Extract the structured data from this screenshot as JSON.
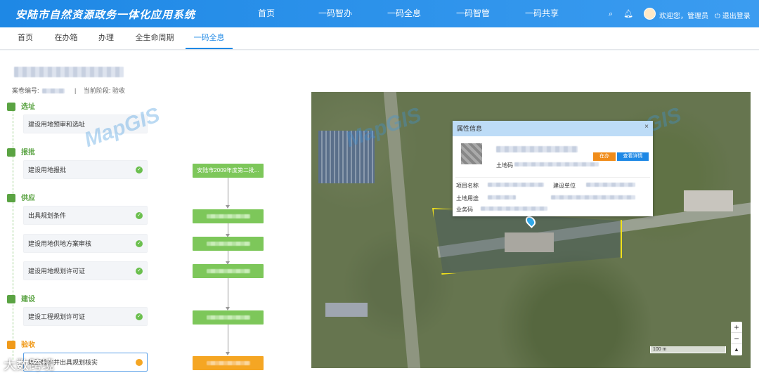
{
  "header": {
    "app_title": "安陆市自然资源政务一体化应用系统",
    "nav": [
      "首页",
      "一码智办",
      "一码全息",
      "一码智管",
      "一码共享"
    ],
    "search_icon": "search-icon",
    "bell_icon": "bell-icon",
    "welcome": "欢迎您，管理员",
    "logout": "退出登录"
  },
  "subnav": {
    "tabs": [
      "首页",
      "在办箱",
      "办理",
      "全生命周期",
      "一码全息"
    ],
    "active": "一码全息"
  },
  "case": {
    "number_label": "案卷编号:",
    "separator": "|",
    "stage_label": "当前阶段:",
    "stage_value": "验收"
  },
  "phases": [
    {
      "name": "选址",
      "icon": "location-icon"
    },
    {
      "name": "报批",
      "icon": "document-icon"
    },
    {
      "name": "供应",
      "icon": "supply-icon"
    },
    {
      "name": "建设",
      "icon": "building-icon"
    },
    {
      "name": "验收",
      "icon": "acceptance-icon"
    }
  ],
  "steps": [
    {
      "label": "建设用地预审和选址"
    },
    {
      "label": "建设用地报批"
    },
    {
      "label": "出具规划条件"
    },
    {
      "label": "建设用地供地方案审核"
    },
    {
      "label": "建设用地规划许可证"
    },
    {
      "label": "建设工程规划许可证"
    },
    {
      "label": "规划核实并出具规划核实"
    }
  ],
  "flow": {
    "first_node": "安陆市2009年度第二批..."
  },
  "popup": {
    "title": "属性信息",
    "close": "×",
    "land_code_label": "土地码",
    "status_button": "在办",
    "detail_button": "查看详情",
    "project_name_label": "项目名称",
    "builder_label": "建设单位",
    "land_use_label": "土地用途",
    "business_code_label": "业务码"
  },
  "map": {
    "zoom_in": "+",
    "zoom_out": "−",
    "compass": "▲",
    "scale": "100 m",
    "watermark": "MapGIS"
  },
  "footer_watermark": "大数跨境",
  "colors": {
    "primary": "#1e88e5",
    "green": "#7dc75a",
    "orange": "#f5a623"
  }
}
